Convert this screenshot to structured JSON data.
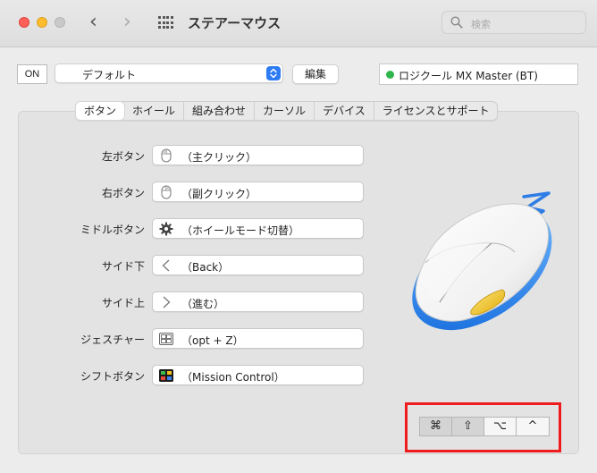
{
  "window": {
    "title": "ステアーマウス",
    "back_icon": "‹",
    "forward_icon": "›",
    "search_placeholder": "検索"
  },
  "toolbar": {
    "on_label": "ON",
    "preset_value": "デフォルト",
    "edit_label": "編集",
    "device_name": "ロジクール MX Master (BT)",
    "device_status_color": "#2fb64a"
  },
  "tabs": [
    {
      "label": "ボタン",
      "active": true
    },
    {
      "label": "ホイール",
      "active": false
    },
    {
      "label": "組み合わせ",
      "active": false
    },
    {
      "label": "カーソル",
      "active": false
    },
    {
      "label": "デバイス",
      "active": false
    },
    {
      "label": "ライセンスとサポート",
      "active": false
    }
  ],
  "buttons": [
    {
      "label": "左ボタン",
      "value": "（主クリック）",
      "icon": "mouse-icon"
    },
    {
      "label": "右ボタン",
      "value": "（副クリック）",
      "icon": "mouse-icon"
    },
    {
      "label": "ミドルボタン",
      "value": "（ホイールモード切替）",
      "icon": "gear-icon"
    },
    {
      "label": "サイド下",
      "value": "（Back）",
      "icon": "chevron-left-icon"
    },
    {
      "label": "サイド上",
      "value": "（進む）",
      "icon": "chevron-right-icon"
    },
    {
      "label": "ジェスチャー",
      "value": "（opt + Z）",
      "icon": "gesture-icon"
    },
    {
      "label": "シフトボタン",
      "value": "（Mission Control）",
      "icon": "mission-control-icon"
    }
  ],
  "modifiers": [
    {
      "symbol": "⌘",
      "name": "command",
      "pressed": true
    },
    {
      "symbol": "⇧",
      "name": "shift",
      "pressed": true
    },
    {
      "symbol": "⌥",
      "name": "option",
      "pressed": false
    },
    {
      "symbol": "^",
      "name": "control",
      "pressed": false
    }
  ],
  "highlight_color": "#ee1c1c"
}
